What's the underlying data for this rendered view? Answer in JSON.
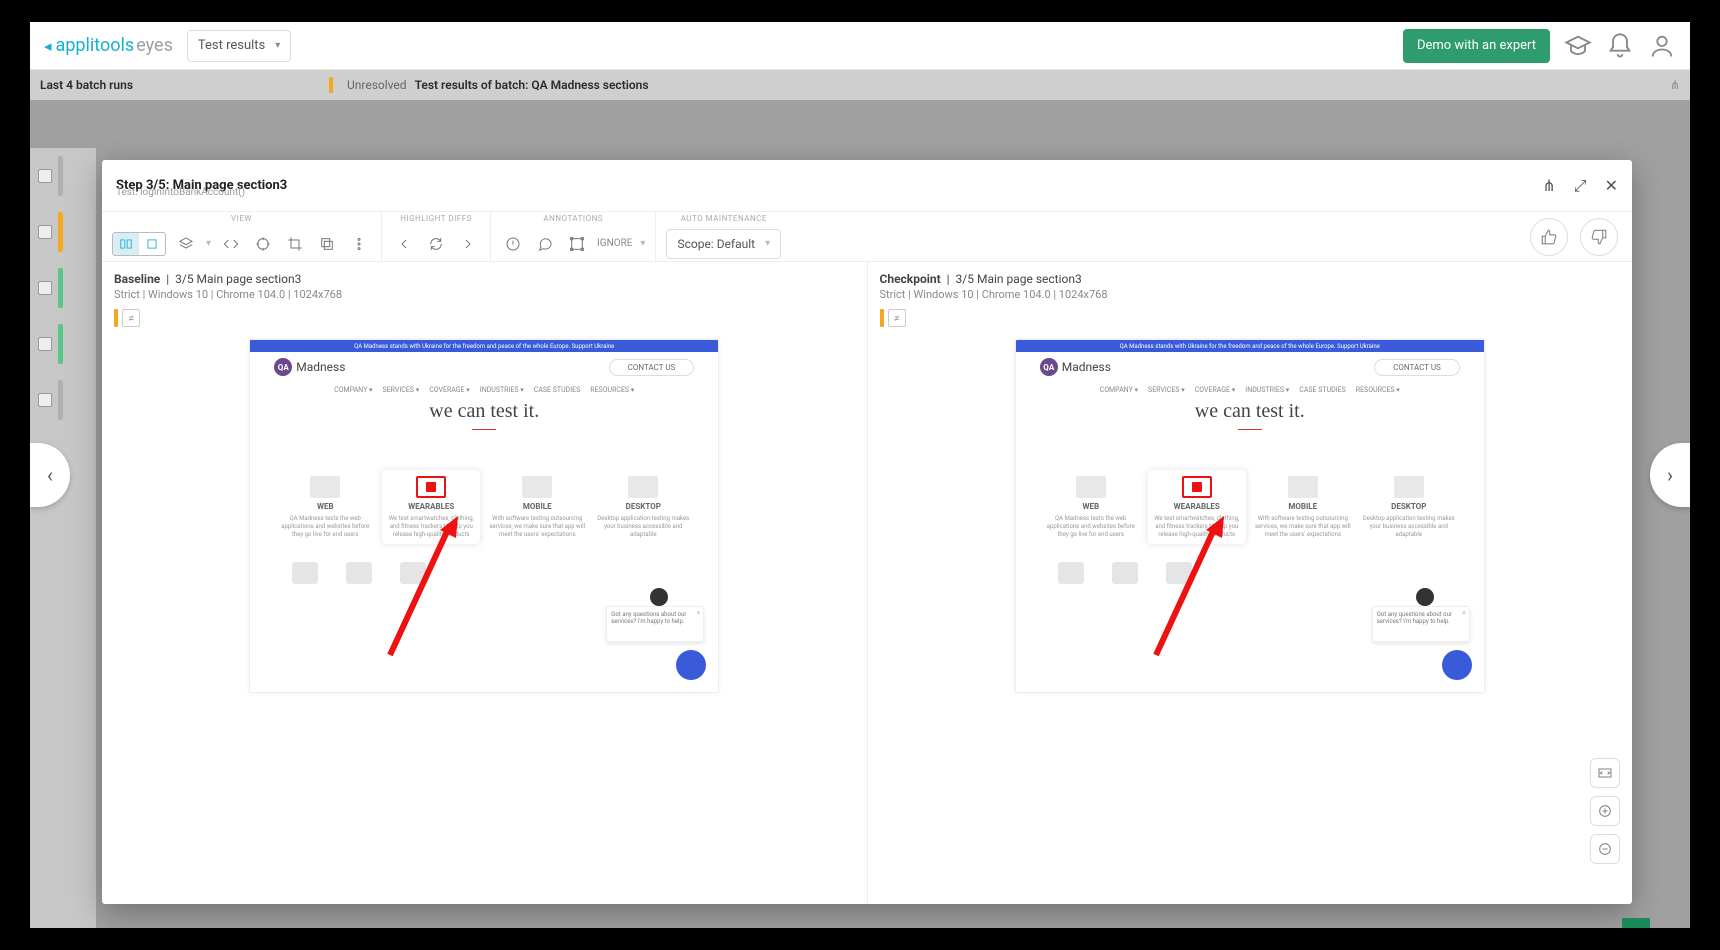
{
  "header": {
    "brand_prefix": "applitools",
    "brand_suffix": "eyes",
    "dropdown_label": "Test results",
    "cta_label": "Demo with an expert"
  },
  "subbar": {
    "left_label": "Last 4 batch runs",
    "status": "Unresolved",
    "prefix": "Test results of batch:",
    "batch_name": "QA Madness sections"
  },
  "modal": {
    "step_label": "Step 3/5:  Main page section3",
    "test_label": "Test: loginIntoBankAccount()",
    "groups": {
      "view": "VIEW",
      "highlight": "HIGHLIGHT DIFFS",
      "annotations": "ANNOTATIONS",
      "auto": "AUTO MAINTENANCE"
    },
    "ignore_label": "IGNORE",
    "scope_label": "Scope: Default"
  },
  "baseline": {
    "title": "Baseline",
    "path": "3/5 Main page section3",
    "meta": "Strict  |  Windows 10  |  Chrome 104.0  |  1024x768"
  },
  "checkpoint": {
    "title": "Checkpoint",
    "path": "3/5 Main page section3",
    "meta": "Strict  |  Windows 10  |  Chrome 104.0  |  1024x768"
  },
  "shot": {
    "banner": "QA Madness stands with Ukraine for the freedom and peace of the whole Europe. Support Ukraine",
    "brand": "Madness",
    "contact": "CONTACT US",
    "nav": [
      "COMPANY ▾",
      "SERVICES ▾",
      "COVERAGE ▾",
      "INDUSTRIES ▾",
      "CASE STUDIES",
      "RESOURCES ▾"
    ],
    "hero": "we can test it.",
    "cards": [
      {
        "name": "WEB",
        "txt": "QA Madness tests the web applications and websites before they go live for end users"
      },
      {
        "name": "WEARABLES",
        "txt": "We test smartwatches, clothing, and fitness trackers to help you release high-quality products"
      },
      {
        "name": "MOBILE",
        "txt": "With software testing outsourcing services, we make sure that app will meet the users' expectations"
      },
      {
        "name": "DESKTOP",
        "txt": "Desktop application testing makes your business accessible and adaptable"
      }
    ],
    "chat_tip": "Got any questions about our services? I'm happy to help."
  }
}
